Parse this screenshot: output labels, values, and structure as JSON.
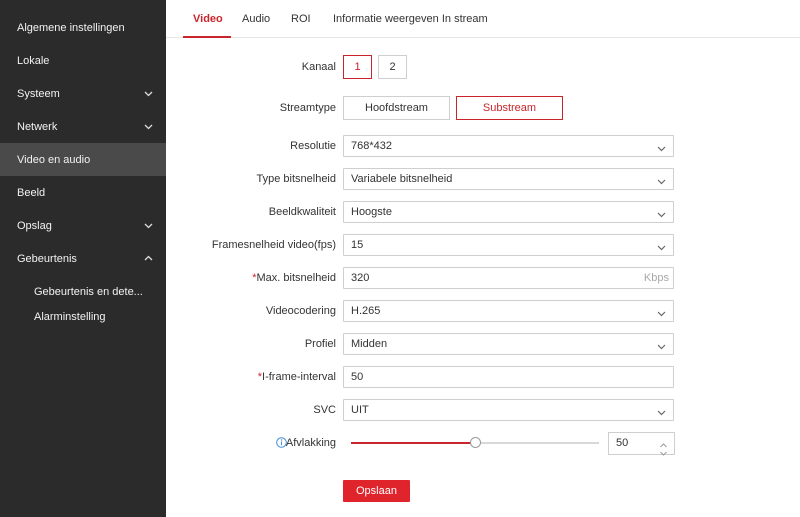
{
  "sidebar": {
    "items": [
      {
        "label": "Algemene instellingen"
      },
      {
        "label": "Lokale"
      },
      {
        "label": "Systeem"
      },
      {
        "label": "Netwerk"
      },
      {
        "label": "Video en audio"
      },
      {
        "label": "Beeld"
      },
      {
        "label": "Opslag"
      },
      {
        "label": "Gebeurtenis"
      },
      {
        "label": "Gebeurtenis en dete..."
      },
      {
        "label": "Alarminstelling"
      }
    ]
  },
  "tabs": [
    {
      "label": "Video"
    },
    {
      "label": "Audio"
    },
    {
      "label": "ROI"
    },
    {
      "label": "Informatie weergeven In stream"
    }
  ],
  "form": {
    "kanaal": {
      "label": "Kanaal",
      "options": [
        "1",
        "2"
      ]
    },
    "streamtype": {
      "label": "Streamtype",
      "options": [
        "Hoofdstream",
        "Substream"
      ]
    },
    "resolutie": {
      "label": "Resolutie",
      "value": "768*432"
    },
    "type_bitsnelheid": {
      "label": "Type bitsnelheid",
      "value": "Variabele bitsnelheid"
    },
    "beeldkwaliteit": {
      "label": "Beeldkwaliteit",
      "value": "Hoogste"
    },
    "framesnelheid": {
      "label": "Framesnelheid video(fps)",
      "value": "15"
    },
    "max_bitsnelheid": {
      "req": "*",
      "label": "Max. bitsnelheid",
      "value": "320",
      "unit": "Kbps"
    },
    "videocodering": {
      "label": "Videocodering",
      "value": "H.265"
    },
    "profiel": {
      "label": "Profiel",
      "value": "Midden"
    },
    "iframe": {
      "req": "*",
      "label": "I-frame-interval",
      "value": "50"
    },
    "svc": {
      "label": "SVC",
      "value": "UIT"
    },
    "afvlakking": {
      "label": "Afvlakking",
      "value": "50",
      "fraction": 0.5
    }
  },
  "save_label": "Opslaan",
  "colors": {
    "accent": "#c9252c",
    "sidebar_bg": "#2b2b2b",
    "sidebar_active": "#4a4a4a"
  }
}
